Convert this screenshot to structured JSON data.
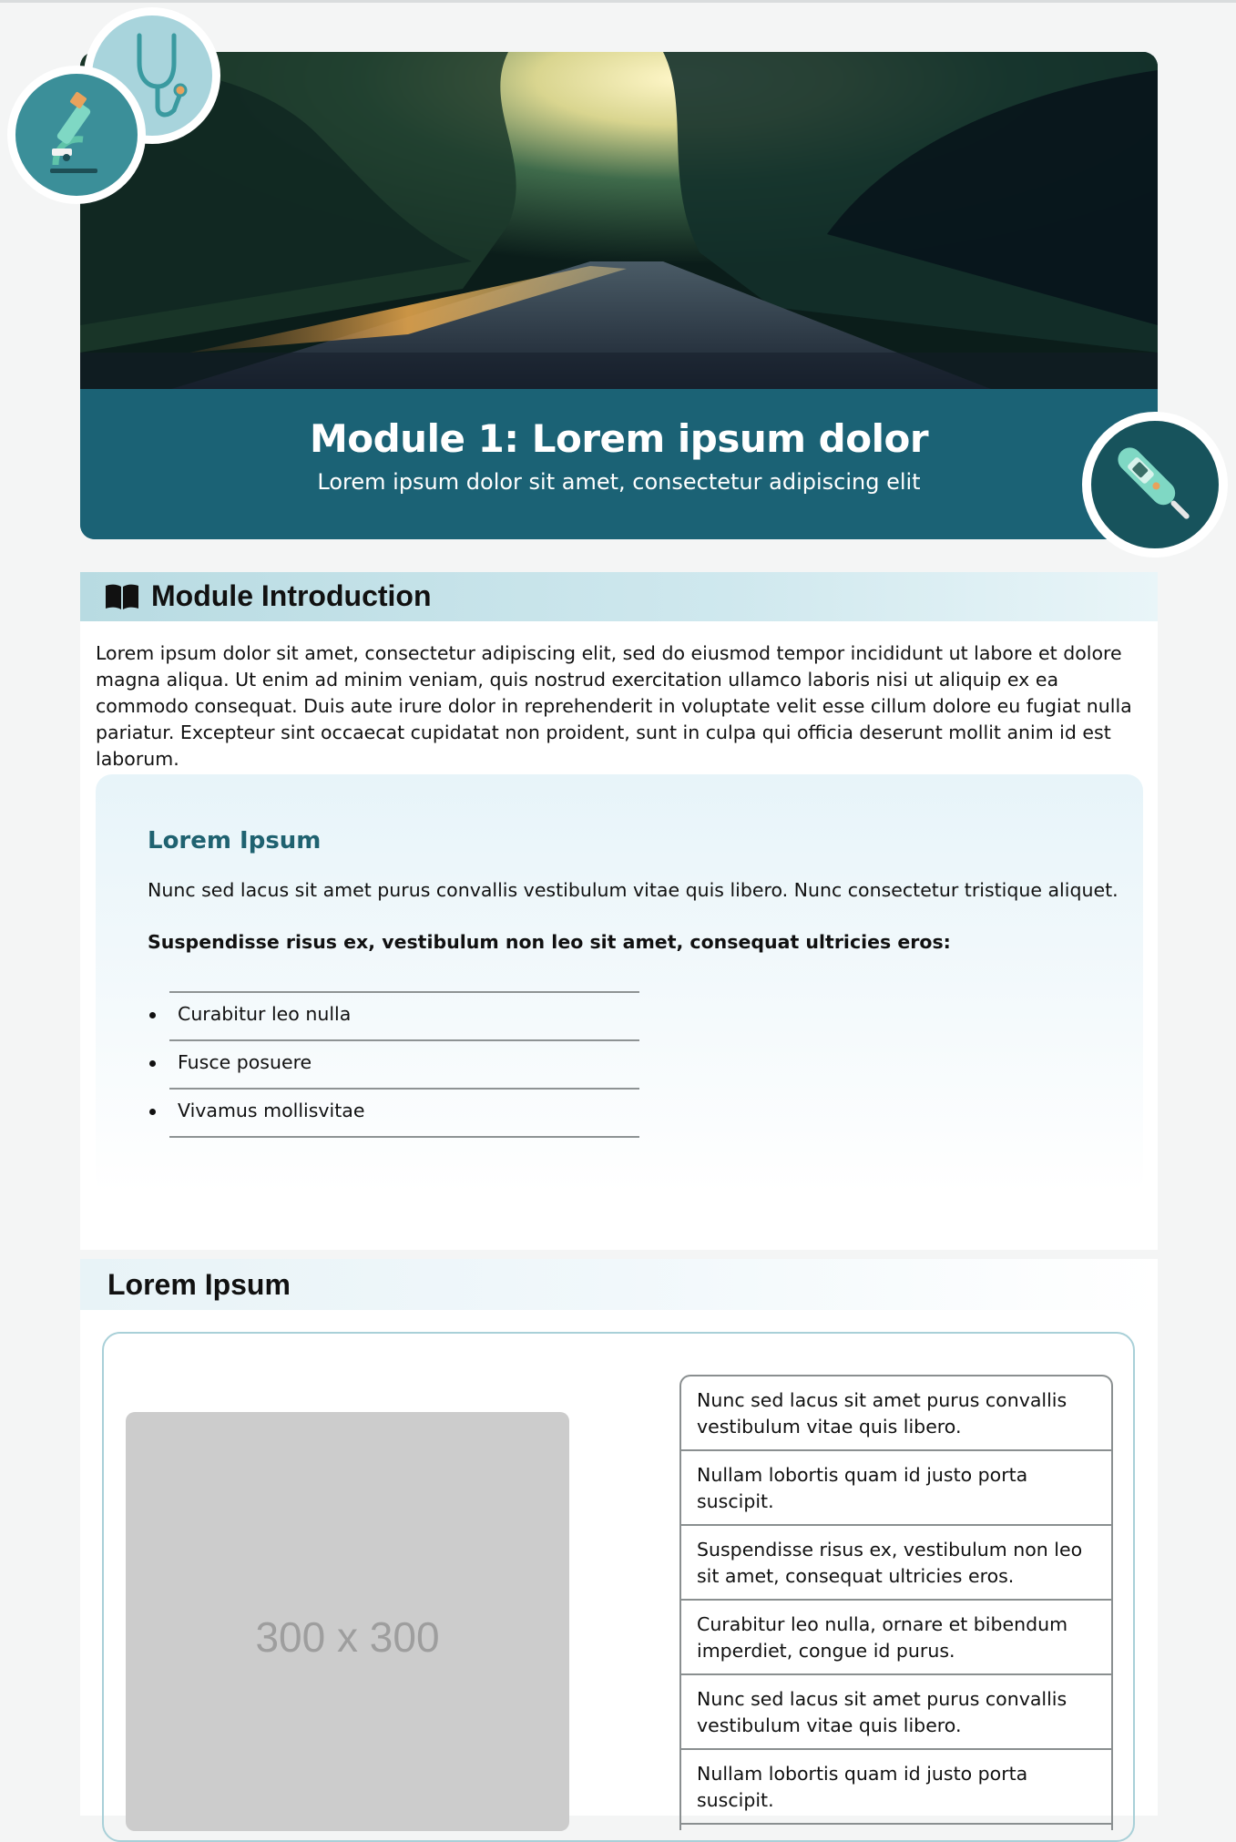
{
  "hero": {
    "title": "Module 1: Lorem ipsum dolor",
    "subtitle": "Lorem ipsum dolor sit amet, consectetur adipiscing elit",
    "badges": [
      "stethoscope-icon",
      "microscope-icon",
      "thermometer-icon"
    ]
  },
  "intro": {
    "heading": "Module Introduction",
    "heading_icon": "book-icon",
    "body": "Lorem ipsum dolor sit amet, consectetur adipiscing elit, sed do eiusmod tempor incididunt ut labore et dolore magna aliqua. Ut enim ad minim veniam, quis nostrud exercitation ullamco laboris nisi ut aliquip ex ea commodo consequat. Duis aute irure dolor in reprehenderit in voluptate velit esse cillum dolore eu fugiat nulla pariatur. Excepteur sint occaecat cupidatat non proident, sunt in culpa qui officia deserunt mollit anim id est laborum.",
    "callout": {
      "title": "Lorem Ipsum",
      "paragraph": "Nunc sed lacus sit amet purus convallis vestibulum vitae quis libero. Nunc consectetur tristique aliquet.",
      "strong": "Suspendisse risus ex, vestibulum non leo sit amet, consequat ultricies eros:",
      "items": [
        "Curabitur leo nulla",
        "Fusce posuere",
        "Vivamus mollisvitae"
      ]
    }
  },
  "section2": {
    "heading": "Lorem Ipsum",
    "image_placeholder": "300 x 300",
    "list": [
      "Nunc sed lacus sit amet purus convallis vestibulum vitae quis libero.",
      "Nullam lobortis quam id justo porta suscipit.",
      "Suspendisse risus ex, vestibulum non leo sit amet, consequat ultricies eros.",
      "Curabitur leo nulla, ornare et bibendum imperdiet, congue id purus.",
      "Nunc sed lacus sit amet purus convallis vestibulum vitae quis libero.",
      "Nullam lobortis quam id justo porta suscipit."
    ]
  },
  "colors": {
    "teal_band": "#1b6275",
    "accent_teal": "#1f6270",
    "light_blue": "#b8dbe2",
    "placeholder_gray": "#cccccc"
  }
}
